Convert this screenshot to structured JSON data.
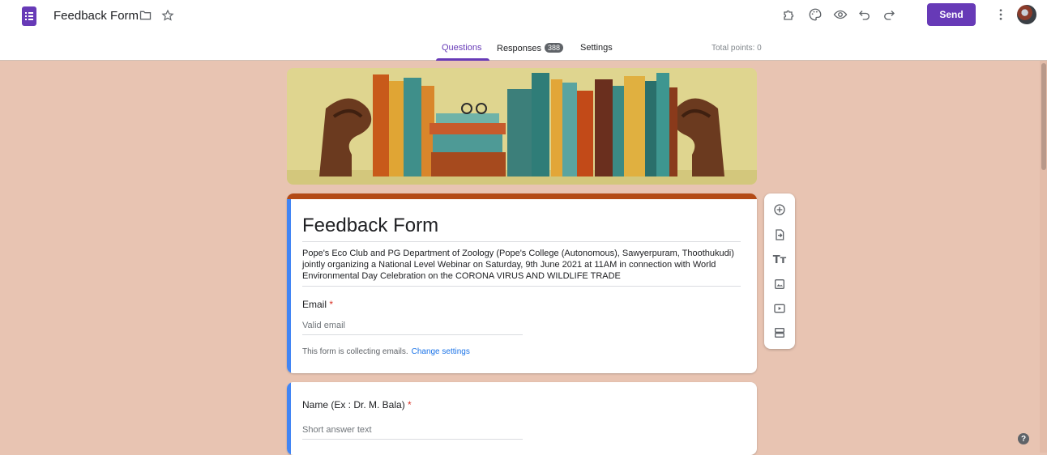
{
  "header": {
    "title": "Feedback Form",
    "send_label": "Send",
    "icons": [
      "forms-app-icon",
      "folder-icon",
      "star-icon",
      "addon-puzzle-icon",
      "palette-icon",
      "preview-eye-icon",
      "undo-icon",
      "redo-icon",
      "more-vert-icon",
      "avatar"
    ]
  },
  "tabs": {
    "questions": "Questions",
    "responses": "Responses",
    "responses_count": "388",
    "settings": "Settings",
    "total_points": "Total points: 0"
  },
  "form": {
    "title": "Feedback Form",
    "description": "Pope's Eco Club and PG Department of Zoology (Pope's College (Autonomous), Sawyerpuram, Thoothukudi) jointly organizing a National Level Webinar on  Saturday, 9th June 2021 at 11AM in connection with World Environmental Day Celebration on the CORONA VIRUS AND WILDLIFE TRADE",
    "email_label": "Email",
    "required_mark": "*",
    "email_placeholder": "Valid email",
    "collecting_note": "This form is collecting emails.",
    "change_settings": "Change settings"
  },
  "questions": [
    {
      "label": "Name (Ex : Dr. M. Bala)",
      "required_mark": "*",
      "placeholder": "Short answer text"
    }
  ],
  "toolbox": {
    "icons": [
      "add-question-icon",
      "import-questions-icon",
      "add-title-icon",
      "add-image-icon",
      "add-video-icon",
      "add-section-icon"
    ],
    "text_icon_glyph": "Tт"
  },
  "colors": {
    "theme_purple": "#673ab7",
    "header_accent": "#b34a16",
    "background": "#e8c4b2",
    "focus_bar": "#4285f4",
    "required_red": "#d93025",
    "link_blue": "#1a73e8"
  },
  "help_glyph": "?"
}
